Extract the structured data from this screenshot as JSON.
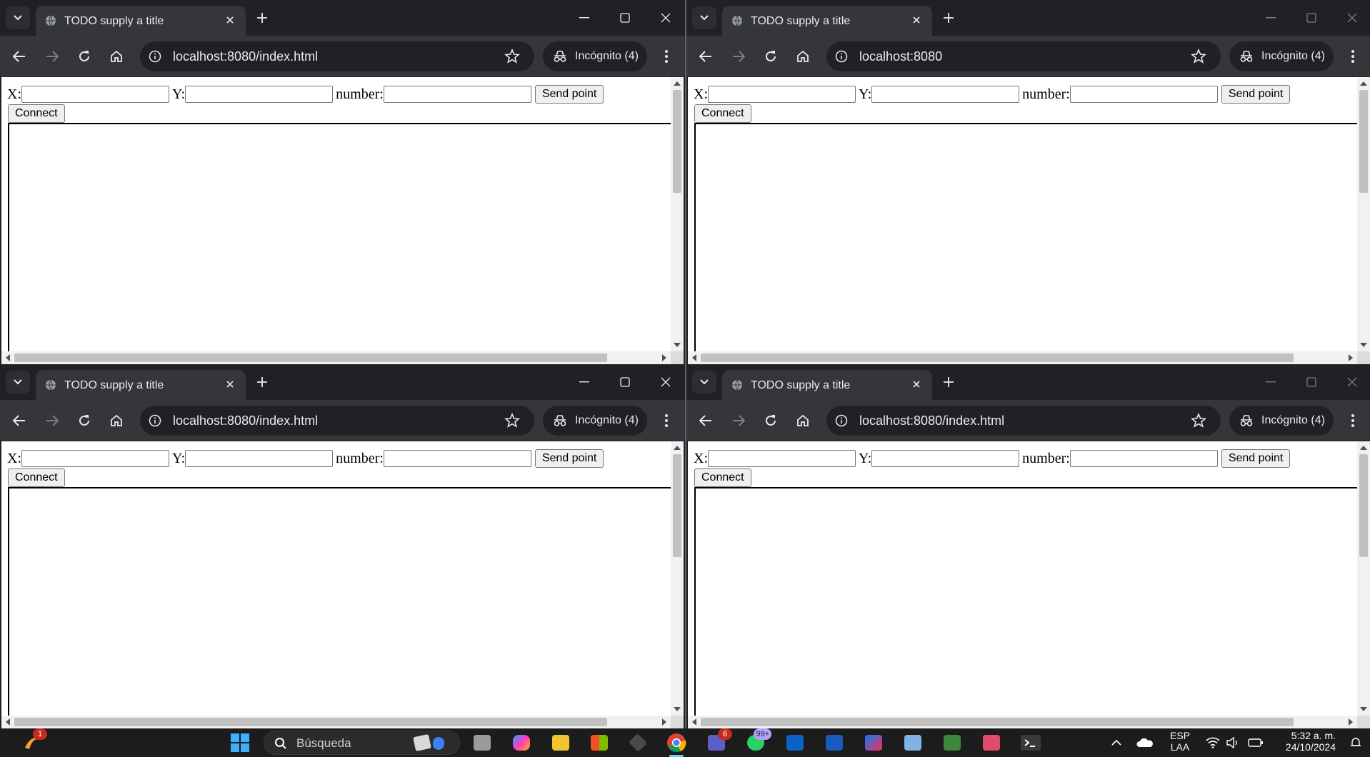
{
  "windows": [
    {
      "tab_title": "TODO supply a title",
      "url": "localhost:8080/index.html",
      "incognito_label": "Incógnito (4)",
      "active": true
    },
    {
      "tab_title": "TODO supply a title",
      "url": "localhost:8080",
      "incognito_label": "Incógnito (4)",
      "active": false
    },
    {
      "tab_title": "TODO supply a title",
      "url": "localhost:8080/index.html",
      "incognito_label": "Incógnito (4)",
      "active": true
    },
    {
      "tab_title": "TODO supply a title",
      "url": "localhost:8080/index.html",
      "incognito_label": "Incógnito (4)",
      "active": false
    }
  ],
  "form": {
    "x_label": "X:",
    "y_label": "Y:",
    "number_label": "number:",
    "x_value": "",
    "y_value": "",
    "number_value": "",
    "send_label": "Send point",
    "connect_label": "Connect"
  },
  "taskbar": {
    "search_placeholder": "Búsqueda",
    "game_badge": "1",
    "teams_badge": "6",
    "whatsapp_badge": "99+",
    "lang": "ESP",
    "lang_sub": "LAA",
    "time": "5:32 a. m.",
    "date": "24/10/2024"
  },
  "icons": [
    "tab-search-icon",
    "globe-icon",
    "close-icon",
    "plus-icon",
    "minimize-icon",
    "maximize-icon",
    "back-icon",
    "forward-icon",
    "reload-icon",
    "home-icon",
    "info-icon",
    "star-icon",
    "incognito-icon",
    "kebab-menu-icon",
    "windows-start-icon",
    "search-icon"
  ],
  "colors": {
    "chrome_dark": "#202124",
    "chrome_toolbar": "#35363a",
    "taskbar": "#1c1c1c"
  }
}
